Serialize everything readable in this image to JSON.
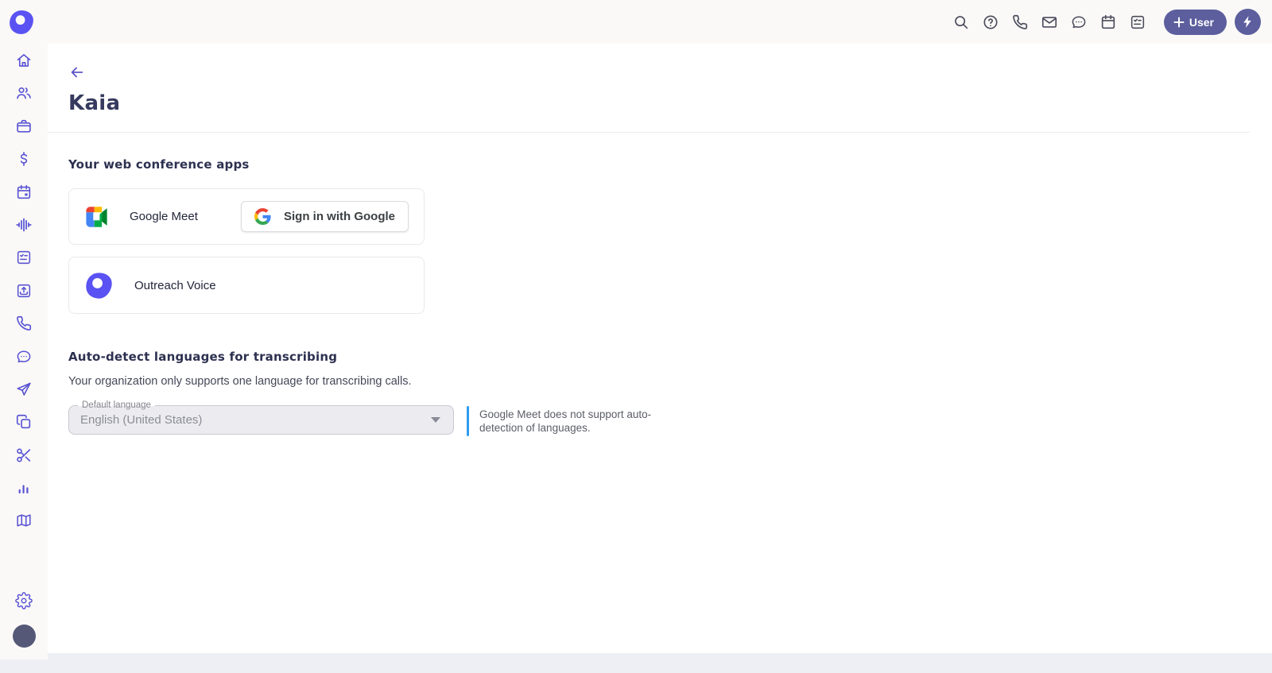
{
  "app": {
    "name": "Outreach"
  },
  "colors": {
    "brand_purple": "#5a52f2",
    "sidebar_icon": "#5a54d4",
    "topbar_icon": "#4b4b5c",
    "user_button": "#5c5e9e",
    "note_accent": "#2d9cf0",
    "title_text": "#363a5e"
  },
  "topbar": {
    "logo_icon": "outreach-logo",
    "action_icons": [
      "search",
      "help",
      "phone",
      "email",
      "chat",
      "calendar",
      "tasks"
    ],
    "user_button": {
      "icon": "plus",
      "label": "User"
    },
    "quick_action_icon": "lightning"
  },
  "sidebar": {
    "items": [
      "home",
      "people",
      "briefcase",
      "currency",
      "calendar",
      "kaia-waveform",
      "tasks",
      "import",
      "calls",
      "chat",
      "send",
      "templates",
      "snippets",
      "reports",
      "plays"
    ],
    "footer": [
      "settings",
      "profile-avatar"
    ]
  },
  "main": {
    "back_icon": "arrow-left",
    "title": "Kaia",
    "conference": {
      "heading": "Your web conference apps",
      "cards": [
        {
          "label": "Google Meet",
          "icon": "google-meet-logo",
          "button_label": "Sign in with Google",
          "button_icon": "google-g-logo"
        },
        {
          "label": "Outreach Voice",
          "icon": "outreach-voice-logo"
        }
      ]
    },
    "languages": {
      "heading": "Auto-detect languages for transcribing",
      "description": "Your organization only supports one language for transcribing calls.",
      "field": {
        "label": "Default language",
        "value": "English (United States)",
        "state": "disabled"
      },
      "note": "Google Meet does not support auto-detection of languages."
    }
  }
}
